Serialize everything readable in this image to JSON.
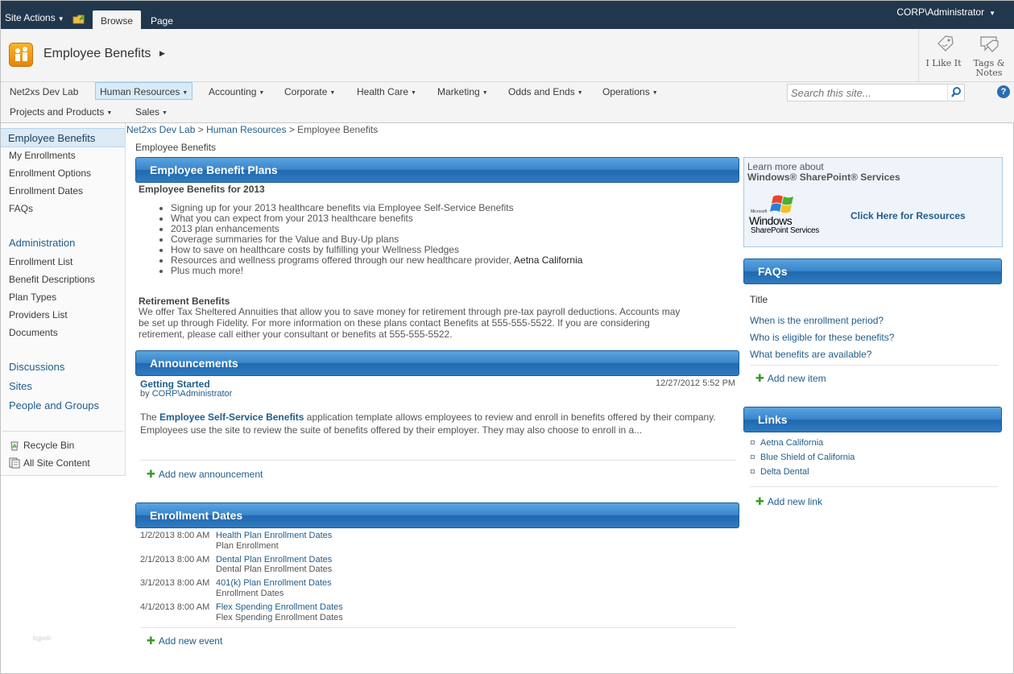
{
  "ribbon": {
    "site_actions": "Site Actions",
    "tabs": [
      {
        "label": "Browse"
      },
      {
        "label": "Page"
      }
    ],
    "user": "CORP\\Administrator"
  },
  "header": {
    "site_title": "Employee Benefits",
    "like_label": "I Like It",
    "tags_label_1": "Tags &",
    "tags_label_2": "Notes"
  },
  "topnav": {
    "items": [
      {
        "label": "Net2xs Dev Lab"
      },
      {
        "label": "Human Resources"
      },
      {
        "label": "Accounting"
      },
      {
        "label": "Corporate"
      },
      {
        "label": "Health Care"
      },
      {
        "label": "Marketing"
      },
      {
        "label": "Odds and Ends"
      },
      {
        "label": "Operations"
      },
      {
        "label": "Projects and Products"
      },
      {
        "label": "Sales"
      }
    ],
    "search_placeholder": "Search this site...",
    "help": "?"
  },
  "quicklaunch": {
    "selected": "Employee Benefits",
    "group1": [
      "My Enrollments",
      "Enrollment Options",
      "Enrollment Dates",
      "FAQs"
    ],
    "admin_head": "Administration",
    "group2": [
      "Enrollment List",
      "Benefit Descriptions",
      "Plan Types",
      "Providers List",
      "Documents"
    ],
    "discussions": "Discussions",
    "sites": "Sites",
    "people": "People and Groups",
    "recycle_bin": "Recycle Bin",
    "all_content": "All Site Content"
  },
  "breadcrumb": {
    "root": "Net2xs Dev Lab",
    "sep": ">",
    "parent": "Human Resources",
    "current": "Employee Benefits"
  },
  "page_title": "Employee Benefits",
  "benefit_plans": {
    "header": "Employee Benefit Plans",
    "subhead": "Employee Benefits for 2013",
    "bullets": [
      "Signing up for your 2013 healthcare benefits via Employee Self-Service Benefits",
      "What you can expect from your 2013 healthcare benefits",
      "2013 plan enhancements",
      "Coverage summaries for the Value and Buy-Up plans",
      "How to save on healthcare costs by fulfilling your Wellness Pledges",
      "Resources and wellness programs offered through our new healthcare provider,",
      "Plus much more!"
    ],
    "provider": "Aetna California",
    "retirement_head": "Retirement Benefits",
    "retirement_l1": "We offer Tax Sheltered Annuities that allow you to save money for retirement through pre-tax payroll deductions. Accounts may",
    "retirement_l2": "be set up through Fidelity. For more information on these plans contact Benefits at 555-555-5522. If you are considering",
    "retirement_l3": "retirement, please call either your consultant or benefits at 555-555-5522."
  },
  "announcements": {
    "header": "Announcements",
    "title": "Getting Started",
    "by_prefix": "by",
    "author": "CORP\\Administrator",
    "date": "12/27/2012 5:52 PM",
    "body_pre": "The",
    "body_link": "Employee Self-Service Benefits",
    "body_post": "application template allows employees to review and enroll in benefits offered by their company.",
    "body_l2": "Employees use the site to review the suite of benefits offered by their employer. They may also choose to enroll in a...",
    "add": "Add new announcement"
  },
  "enrollment_dates": {
    "header": "Enrollment Dates",
    "events": [
      {
        "date": "1/2/2013 8:00 AM",
        "title": "Health Plan Enrollment Dates",
        "sub": "Plan Enrollment"
      },
      {
        "date": "2/1/2013 8:00 AM",
        "title": "Dental Plan Enrollment Dates",
        "sub": "Dental Plan Enrollment Dates"
      },
      {
        "date": "3/1/2013 8:00 AM",
        "title": "401(k) Plan Enrollment Dates",
        "sub": "Enrollment Dates"
      },
      {
        "date": "4/1/2013 8:00 AM",
        "title": "Flex Spending Enrollment Dates",
        "sub": "Flex Spending Enrollment Dates"
      }
    ],
    "add": "Add new event"
  },
  "resources": {
    "learn": "Learn more about",
    "product": "Windows® SharePoint® Services",
    "logo_ms": "Microsoft",
    "logo_win": "Windows",
    "logo_sps": "SharePoint Services",
    "click": "Click Here for Resources"
  },
  "faqs": {
    "header": "FAQs",
    "col_title": "Title",
    "items": [
      "When is the enrollment period?",
      "Who is eligible for these benefits?",
      "What benefits are available?"
    ],
    "add": "Add new item"
  },
  "links": {
    "header": "Links",
    "items": [
      "Aetna California",
      "Blue Shield of California",
      "Delta Dental"
    ],
    "add": "Add new link"
  },
  "watermark": "bgpeb"
}
